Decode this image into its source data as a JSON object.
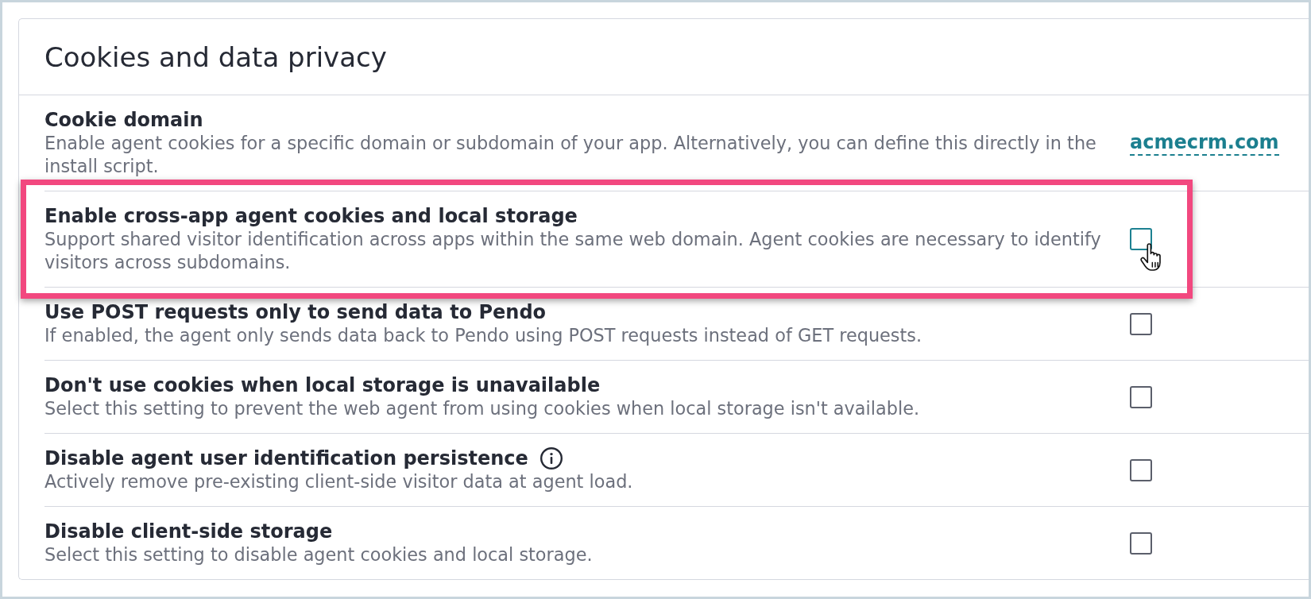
{
  "section": {
    "title": "Cookies and data privacy"
  },
  "settings": [
    {
      "kind": "link",
      "title": "Cookie domain",
      "description": "Enable agent cookies for a specific domain or subdomain of your app. Alternatively, you can define this directly in the install script.",
      "value": "acmecrm.com",
      "highlighted": false,
      "info_icon": false
    },
    {
      "kind": "checkbox",
      "title": "Enable cross-app agent cookies and local storage",
      "description": "Support shared visitor identification across apps within the same web domain. Agent cookies are necessary to identify visitors across subdomains.",
      "checked": false,
      "hovered": true,
      "highlighted": true,
      "info_icon": false
    },
    {
      "kind": "checkbox",
      "title": "Use POST requests only to send data to Pendo",
      "description": "If enabled, the agent only sends data back to Pendo using POST requests instead of GET requests.",
      "checked": false,
      "hovered": false,
      "highlighted": false,
      "info_icon": false
    },
    {
      "kind": "checkbox",
      "title": "Don't use cookies when local storage is unavailable",
      "description": "Select this setting to prevent the web agent from using cookies when local storage isn't available.",
      "checked": false,
      "hovered": false,
      "highlighted": false,
      "info_icon": false
    },
    {
      "kind": "checkbox",
      "title": "Disable agent user identification persistence",
      "description": "Actively remove pre-existing client-side visitor data at agent load.",
      "checked": false,
      "hovered": false,
      "highlighted": false,
      "info_icon": true
    },
    {
      "kind": "checkbox",
      "title": "Disable client-side storage",
      "description": "Select this setting to disable agent cookies and local storage.",
      "checked": false,
      "hovered": false,
      "highlighted": false,
      "info_icon": false
    }
  ]
}
